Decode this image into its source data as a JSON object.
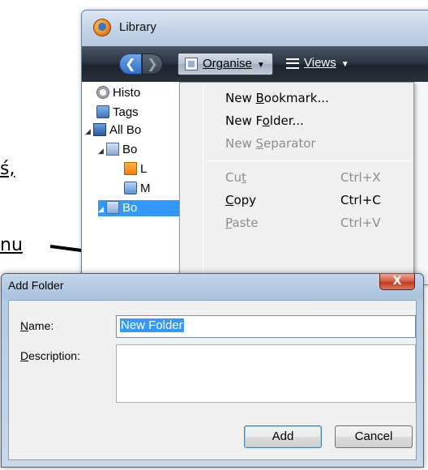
{
  "doc": {
    "fragment_top": "ś,",
    "fragment_bottom": "nu"
  },
  "library": {
    "title": "Library",
    "toolbar": {
      "organise": "Organise",
      "views": "Views"
    },
    "tree": [
      {
        "label": "Histo",
        "icon": "history-clock-icon"
      },
      {
        "label": "Tags",
        "icon": "tags-icon"
      },
      {
        "label": "All Bo",
        "icon": "all-bookmarks-icon"
      },
      {
        "label": "Bo",
        "icon": "bookmarks-folder-icon"
      },
      {
        "label": "L",
        "icon": "rss-feed-icon"
      },
      {
        "label": "M",
        "icon": "smart-folder-icon"
      },
      {
        "label": "Bo",
        "icon": "bookmarks-menu-icon"
      }
    ]
  },
  "menu": {
    "new_bookmark": {
      "pre": "New ",
      "ul": "B",
      "post": "ookmark..."
    },
    "new_folder": {
      "pre": "New F",
      "ul": "o",
      "post": "lder..."
    },
    "new_separator": {
      "pre": "New ",
      "ul": "S",
      "post": "eparator"
    },
    "cut": {
      "pre": "Cu",
      "ul": "t",
      "post": "",
      "shortcut": "Ctrl+X"
    },
    "copy": {
      "pre": "",
      "ul": "C",
      "post": "opy",
      "shortcut": "Ctrl+C"
    },
    "paste": {
      "pre": "",
      "ul": "P",
      "post": "aste",
      "shortcut": "Ctrl+V"
    }
  },
  "dialog": {
    "title": "Add Folder",
    "close_glyph": "X",
    "name_label": {
      "ul": "N",
      "post": "ame:"
    },
    "name_value": "New Folder",
    "description_label": {
      "ul": "D",
      "post": "escription:"
    },
    "description_value": "",
    "add_button": "Add",
    "cancel_button": "Cancel"
  },
  "colors": {
    "selection": "#3399ff",
    "toolbar_dark": "#2e3644",
    "dialog_frame": "#b5cbe4"
  }
}
